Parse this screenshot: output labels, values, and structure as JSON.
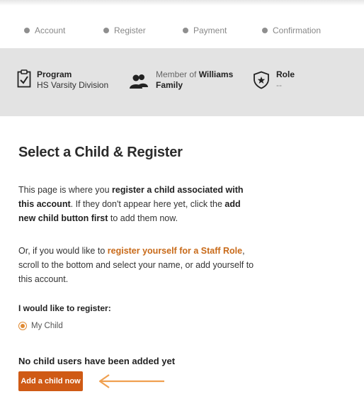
{
  "progress": {
    "steps": [
      "Account",
      "Register",
      "Payment",
      "Confirmation"
    ]
  },
  "info": {
    "program_label": "Program",
    "program_value": "HS Varsity Division",
    "member_prefix": "Member of",
    "member_name": "Williams",
    "member_suffix": "Family",
    "role_label": "Role",
    "role_value": "--"
  },
  "main": {
    "title": "Select a Child & Register",
    "p1": {
      "a": "This page is where you ",
      "b": "register a child associated with this account",
      "c": ". If they don't appear here yet, click the ",
      "d": "add new child button first",
      "e": " to add them now."
    },
    "p2": {
      "a": "Or, if you would like to ",
      "b": "register yourself for a Staff Role",
      "c": ", scroll to the bottom and select your name, or add yourself to this account."
    },
    "register_label": "I would like to register:",
    "radio_option": "My Child",
    "no_child_text": "No child users have been added yet",
    "add_button": "Add a child now"
  },
  "colors": {
    "accent": "#cf5a15",
    "info_bar": "#e3e3e3",
    "link_orange": "#c86a19",
    "arrow": "#f0a050"
  },
  "icons": [
    "clipboard-check-icon",
    "people-icon",
    "star-badge-icon",
    "arrow-left-icon"
  ]
}
